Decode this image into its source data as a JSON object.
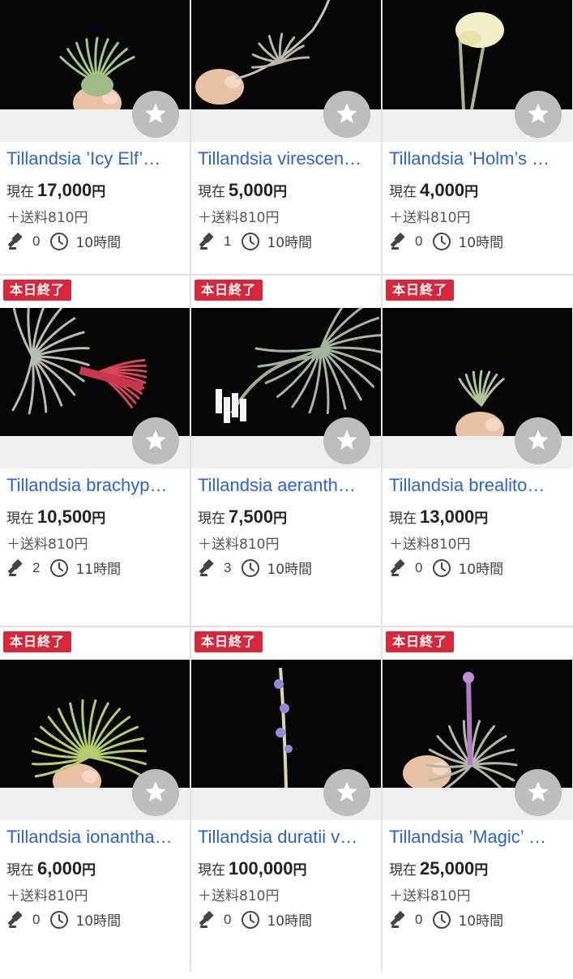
{
  "accent_colors": {
    "title_link": "#2c64c9",
    "badge": "#d8263b",
    "watch_button": "#bdbdbd"
  },
  "price_prefix": "現在",
  "price_suffix": "円",
  "items": [
    {
      "title": "Tillandsia ’Icy Elf’…",
      "badge": "",
      "price": "17,000",
      "shipping": "＋送料810円",
      "bids": "0",
      "time_left": "10時間",
      "photo": "held-plant-green"
    },
    {
      "title": "Tillandsia virescen…",
      "badge": "",
      "price": "5,000",
      "shipping": "＋送料810円",
      "bids": "1",
      "time_left": "10時間",
      "photo": "held-wiry-plant"
    },
    {
      "title": "Tillandsia ’Holm’s …",
      "badge": "",
      "price": "4,000",
      "shipping": "＋送料810円",
      "bids": "0",
      "time_left": "10時間",
      "photo": "yellow-flower"
    },
    {
      "title": "Tillandsia brachyp…",
      "badge": "本日終了",
      "price": "10,500",
      "shipping": "＋送料810円",
      "bids": "2",
      "time_left": "11時間",
      "photo": "silver-plant-red-spike"
    },
    {
      "title": "Tillandsia aeranth…",
      "badge": "本日終了",
      "price": "7,500",
      "shipping": "＋送料810円",
      "bids": "3",
      "time_left": "10時間",
      "photo": "silver-plant-white-flowers"
    },
    {
      "title": "Tillandsia brealito…",
      "badge": "本日終了",
      "price": "13,000",
      "shipping": "＋送料810円",
      "bids": "0",
      "time_left": "10時間",
      "photo": "held-small-plant"
    },
    {
      "title": "Tillandsia ionantha…",
      "badge": "本日終了",
      "price": "6,000",
      "shipping": "＋送料810円",
      "bids": "0",
      "time_left": "10時間",
      "photo": "held-spiky-green"
    },
    {
      "title": "Tillandsia duratii v…",
      "badge": "本日終了",
      "price": "100,000",
      "shipping": "＋送料810円",
      "bids": "0",
      "time_left": "10時間",
      "photo": "tall-purple-spike"
    },
    {
      "title": "Tillandsia ’Magic’ …",
      "badge": "本日終了",
      "price": "25,000",
      "shipping": "＋送料810円",
      "bids": "0",
      "time_left": "10時間",
      "photo": "held-plant-purple-spike"
    }
  ]
}
